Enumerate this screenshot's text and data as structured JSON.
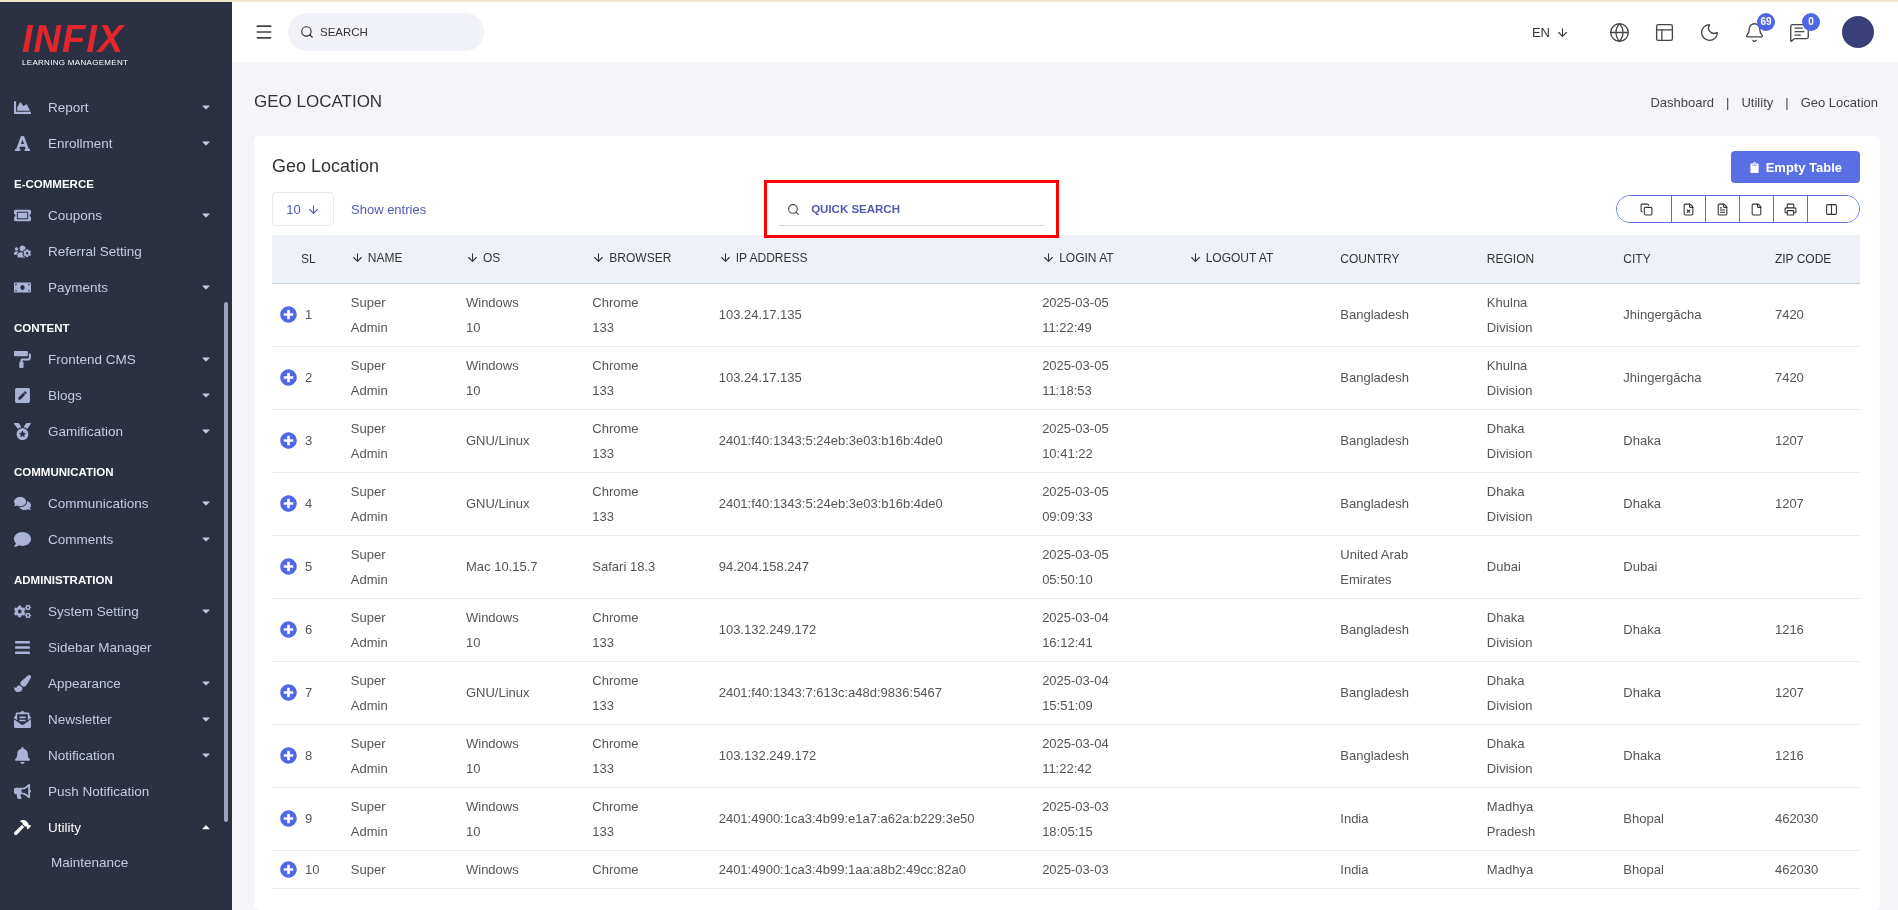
{
  "sidebar": {
    "logo": {
      "name": "INFIX",
      "tagline": "LEARNING MANAGEMENT"
    },
    "sections": [
      {
        "items": [
          {
            "label": "Report",
            "expanded": false,
            "selected": false
          },
          {
            "label": "Enrollment",
            "expanded": false,
            "selected": false
          }
        ]
      },
      {
        "title": "E-COMMERCE",
        "items": [
          {
            "label": "Coupons",
            "expanded": false,
            "selected": false
          },
          {
            "label": "Referral Setting",
            "selected": false
          },
          {
            "label": "Payments",
            "expanded": false,
            "selected": false
          }
        ]
      },
      {
        "title": "CONTENT",
        "items": [
          {
            "label": "Frontend CMS",
            "expanded": false,
            "selected": false
          },
          {
            "label": "Blogs",
            "expanded": false,
            "selected": false
          },
          {
            "label": "Gamification",
            "expanded": false,
            "selected": false
          }
        ]
      },
      {
        "title": "COMMUNICATION",
        "items": [
          {
            "label": "Communications",
            "expanded": false,
            "selected": false
          },
          {
            "label": "Comments",
            "expanded": false,
            "selected": false
          }
        ]
      },
      {
        "title": "ADMINISTRATION",
        "items": [
          {
            "label": "System Setting",
            "expanded": false,
            "selected": false
          },
          {
            "label": "Sidebar Manager",
            "selected": false
          },
          {
            "label": "Appearance",
            "expanded": false,
            "selected": false
          },
          {
            "label": "Newsletter",
            "expanded": false,
            "selected": false
          },
          {
            "label": "Notification",
            "expanded": false,
            "selected": false
          },
          {
            "label": "Push Notification",
            "selected": false
          },
          {
            "label": "Utility",
            "expanded": true,
            "selected": true,
            "children": [
              {
                "label": "Maintenance",
                "selected": false
              }
            ]
          }
        ]
      }
    ]
  },
  "topbar": {
    "search": {
      "placeholder": "SEARCH"
    },
    "language": "EN",
    "notifications_count": "69",
    "messages_count": "0"
  },
  "page": {
    "title": "GEO LOCATION",
    "breadcrumb": [
      {
        "label": "Dashboard",
        "separator": "|"
      },
      {
        "label": "Utility",
        "separator": "|"
      },
      {
        "label": "Geo Location"
      }
    ]
  },
  "card": {
    "title": "Geo Location",
    "empty_button": "Empty Table",
    "page_size": "10",
    "page_size_label": "Show entries",
    "quick_search": {
      "placeholder": "QUICK SEARCH",
      "highlighted": true
    },
    "table": {
      "columns": [
        {
          "label": "SL",
          "sortable": false
        },
        {
          "label": "NAME",
          "sortable": true
        },
        {
          "label": "OS",
          "sortable": true
        },
        {
          "label": "BROWSER",
          "sortable": true
        },
        {
          "label": "IP ADDRESS",
          "sortable": true
        },
        {
          "label": "LOGIN AT",
          "sortable": true
        },
        {
          "label": "LOGOUT AT",
          "sortable": true
        },
        {
          "label": "COUNTRY",
          "sortable": false
        },
        {
          "label": "REGION",
          "sortable": false
        },
        {
          "label": "CITY",
          "sortable": false
        },
        {
          "label": "ZIP CODE",
          "sortable": false
        }
      ],
      "rows": [
        [
          "1",
          "Super\nAdmin",
          "Windows\n10",
          "Chrome\n133",
          "103.24.17.135",
          "2025-03-05\n11:22:49",
          null,
          "Bangladesh",
          "Khulna\nDivision",
          "Jhingergācha",
          "7420"
        ],
        [
          "2",
          "Super\nAdmin",
          "Windows\n10",
          "Chrome\n133",
          "103.24.17.135",
          "2025-03-05\n11:18:53",
          null,
          "Bangladesh",
          "Khulna\nDivision",
          "Jhingergācha",
          "7420"
        ],
        [
          "3",
          "Super\nAdmin",
          "GNU/Linux",
          "Chrome\n133",
          "2401:f40:1343:5:24eb:3e03:b16b:4de0",
          "2025-03-05\n10:41:22",
          null,
          "Bangladesh",
          "Dhaka\nDivision",
          "Dhaka",
          "1207"
        ],
        [
          "4",
          "Super\nAdmin",
          "GNU/Linux",
          "Chrome\n133",
          "2401:f40:1343:5:24eb:3e03:b16b:4de0",
          "2025-03-05\n09:09:33",
          null,
          "Bangladesh",
          "Dhaka\nDivision",
          "Dhaka",
          "1207"
        ],
        [
          "5",
          "Super\nAdmin",
          "Mac 10.15.7",
          "Safari 18.3",
          "94.204.158.247",
          "2025-03-05\n05:50:10",
          null,
          "United Arab\nEmirates",
          "Dubai",
          "Dubai",
          null
        ],
        [
          "6",
          "Super\nAdmin",
          "Windows\n10",
          "Chrome\n133",
          "103.132.249.172",
          "2025-03-04\n16:12:41",
          null,
          "Bangladesh",
          "Dhaka\nDivision",
          "Dhaka",
          "1216"
        ],
        [
          "7",
          "Super\nAdmin",
          "GNU/Linux",
          "Chrome\n133",
          "2401:f40:1343:7:613c:a48d:9836:5467",
          "2025-03-04\n15:51:09",
          null,
          "Bangladesh",
          "Dhaka\nDivision",
          "Dhaka",
          "1207"
        ],
        [
          "8",
          "Super\nAdmin",
          "Windows\n10",
          "Chrome\n133",
          "103.132.249.172",
          "2025-03-04\n11:22:42",
          null,
          "Bangladesh",
          "Dhaka\nDivision",
          "Dhaka",
          "1216"
        ],
        [
          "9",
          "Super\nAdmin",
          "Windows\n10",
          "Chrome\n133",
          "2401:4900:1ca3:4b99:e1a7:a62a:b229:3e50",
          "2025-03-03\n18:05:15",
          null,
          "India",
          "Madhya\nPradesh",
          "Bhopal",
          "462030"
        ],
        [
          "10",
          "Super",
          "Windows",
          "Chrome",
          "2401:4900:1ca3:4b99:1aa:a8b2:49cc:82a0",
          "2025-03-03",
          null,
          "India",
          "Madhya",
          "Bhopal",
          "462030"
        ]
      ]
    }
  }
}
